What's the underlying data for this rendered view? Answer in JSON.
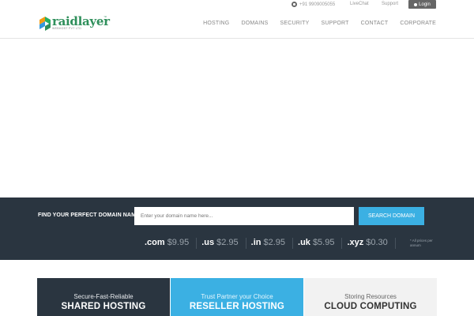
{
  "topbar": {
    "phone": "+91 9909005055",
    "livechat": "LiveChat",
    "support": "Support",
    "login": "Login"
  },
  "brand": {
    "name": "raidlayer",
    "tm": "™",
    "subtitle": "WEBHOST PVT LTD"
  },
  "nav": {
    "items": [
      "HOSTING",
      "DOMAINS",
      "SECURITY",
      "SUPPORT",
      "CONTACT",
      "CORPORATE"
    ]
  },
  "domain_search": {
    "label": "FIND YOUR PERFECT DOMAIN NAME:",
    "placeholder": "Enter your domain name here...",
    "button": "SEARCH DOMAIN",
    "prices": [
      {
        "tld": ".com",
        "price": "$9.95"
      },
      {
        "tld": ".us",
        "price": "$2.95"
      },
      {
        "tld": ".in",
        "price": "$2.95"
      },
      {
        "tld": ".uk",
        "price": "$5.95"
      },
      {
        "tld": ".xyz",
        "price": "$0.30"
      }
    ],
    "note": "* All prices per annum"
  },
  "cards": [
    {
      "tagline": "Secure-Fast-Reliable",
      "title": "SHARED HOSTING"
    },
    {
      "tagline": "Trust Partner your Choice",
      "title": "RESELLER HOSTING"
    },
    {
      "tagline": "Storing Resources",
      "title": "CLOUD COMPUTING"
    }
  ],
  "colors": {
    "dark": "#2a3540",
    "accent": "#3bb0e3",
    "brand_green": "#2f8f5b"
  }
}
